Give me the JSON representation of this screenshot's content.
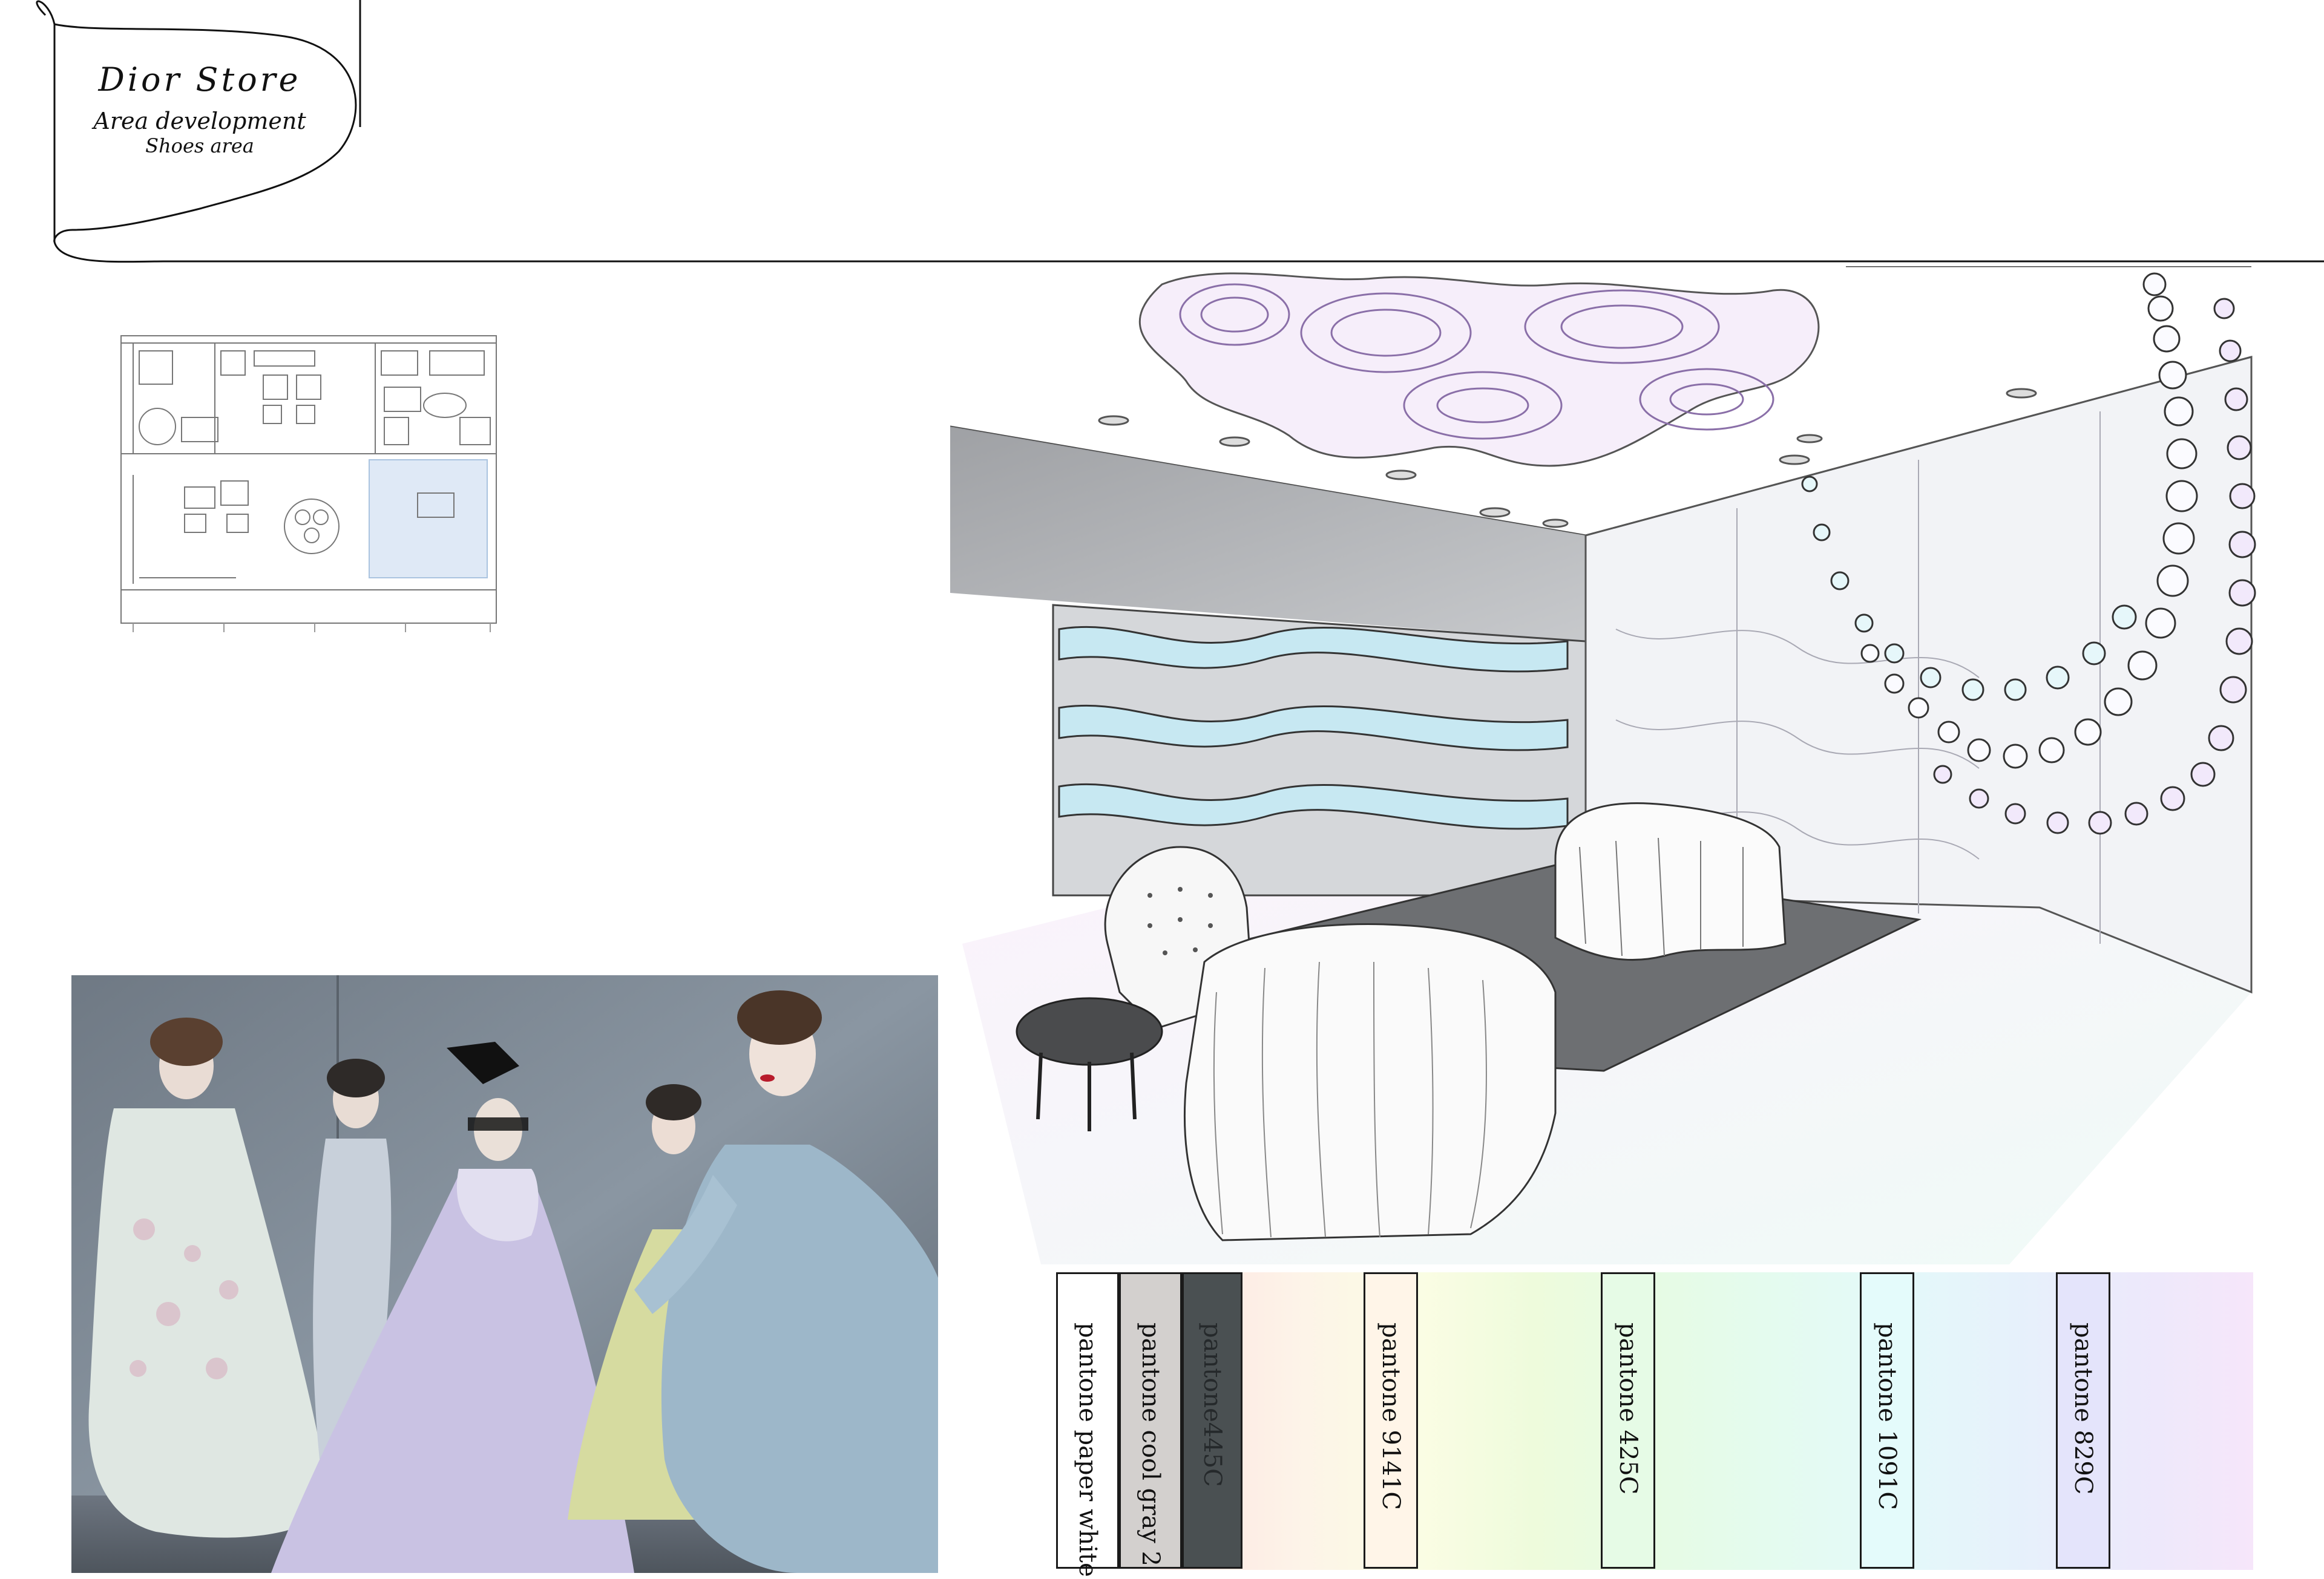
{
  "header": {
    "title": "Dior Store",
    "subtitle": "Area development",
    "area": "Shoes area"
  },
  "palette": {
    "swatches": [
      {
        "label": "pantone paper white",
        "color": "#ffffff",
        "text_color": "#111111"
      },
      {
        "label": "pantone cool gray 2",
        "color": "#d3d0ce",
        "text_color": "#111111"
      },
      {
        "label": "pantone445C",
        "color": "#4a5052",
        "text_color": "#25292b"
      },
      {
        "label": "pantone 9141C",
        "color": "#fff5e8",
        "text_color": "#111111"
      },
      {
        "label": "pantone 425C",
        "color": "#e6fbe6",
        "text_color": "#111111"
      },
      {
        "label": "pantone 1091C",
        "color": "#e4fbfb",
        "text_color": "#111111"
      },
      {
        "label": "pantone 829C",
        "color": "#e4e4fb",
        "text_color": "#111111"
      }
    ]
  }
}
